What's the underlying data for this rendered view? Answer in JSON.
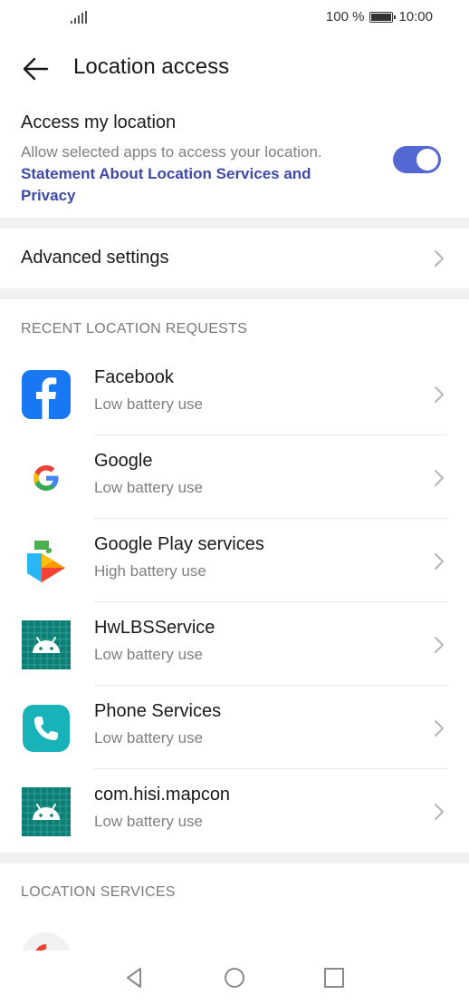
{
  "status_bar": {
    "battery_percent": "100 %",
    "time": "10:00"
  },
  "header": {
    "title": "Location access"
  },
  "access": {
    "title": "Access my location",
    "description": "Allow selected apps to access your location.",
    "link": "Statement About Location Services and Privacy",
    "enabled": true
  },
  "advanced": {
    "label": "Advanced settings"
  },
  "recent": {
    "header": "RECENT LOCATION REQUESTS",
    "apps": [
      {
        "name": "Facebook",
        "usage": "Low battery use",
        "icon": "facebook-icon"
      },
      {
        "name": "Google",
        "usage": "Low battery use",
        "icon": "google-icon"
      },
      {
        "name": "Google Play services",
        "usage": "High battery use",
        "icon": "google-play-services-icon"
      },
      {
        "name": "HwLBSService",
        "usage": "Low battery use",
        "icon": "android-icon"
      },
      {
        "name": "Phone Services",
        "usage": "Low battery use",
        "icon": "phone-services-icon"
      },
      {
        "name": "com.hisi.mapcon",
        "usage": "Low battery use",
        "icon": "android-icon"
      }
    ]
  },
  "services": {
    "header": "LOCATION SERVICES"
  },
  "colors": {
    "accent": "#5468d4",
    "link": "#3d4aa8",
    "secondary_text": "#808080",
    "divider": "#f1f1f1"
  }
}
